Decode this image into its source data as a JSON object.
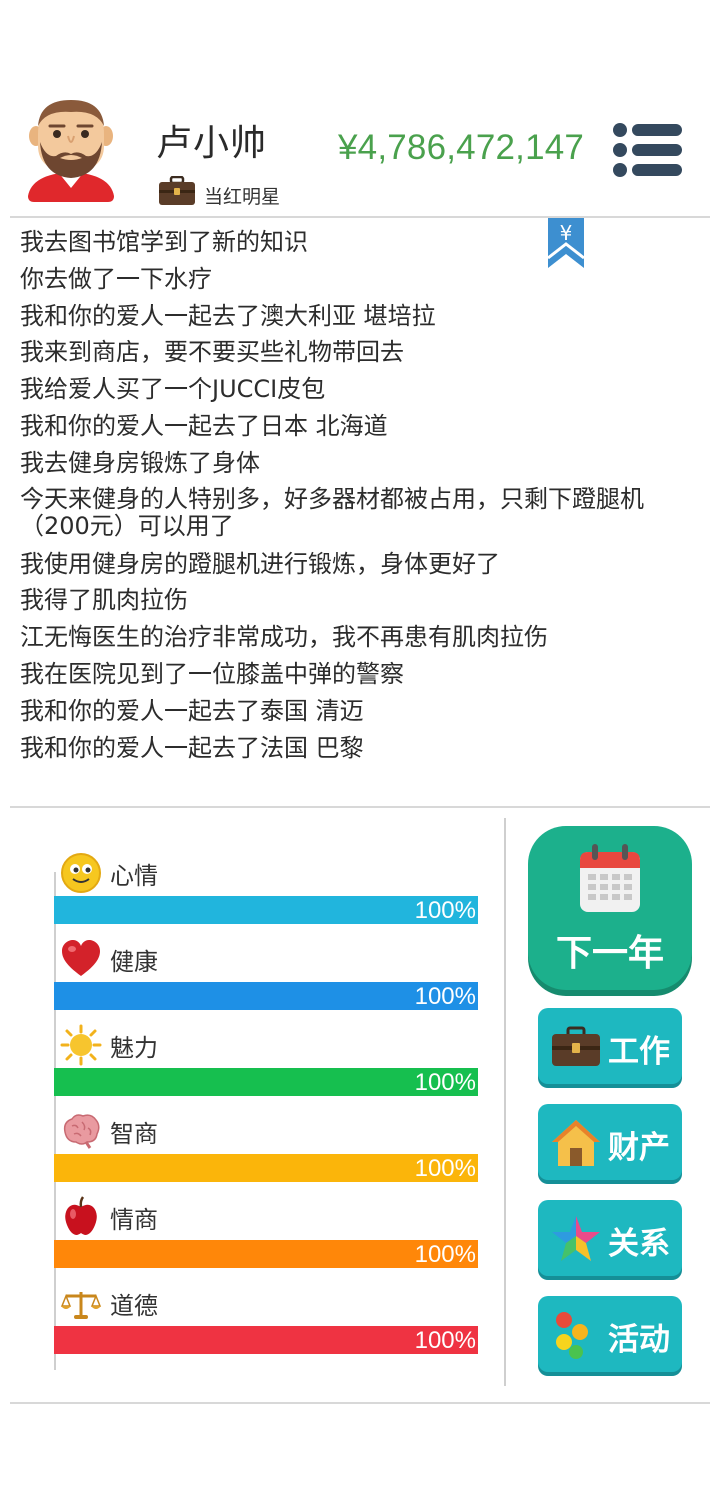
{
  "player": {
    "name": "卢小帅",
    "job": "当红明星",
    "money": "¥4,786,472,147"
  },
  "log": [
    "我去图书馆学到了新的知识",
    "你去做了一下水疗",
    "我和你的爱人一起去了澳大利亚 堪培拉",
    "我来到商店，要不要买些礼物带回去",
    "我给爱人买了一个JUCCI皮包",
    "我和你的爱人一起去了日本 北海道",
    "我去健身房锻炼了身体",
    "今天来健身的人特别多，好多器材都被占用，只剩下蹬腿机（200元）可以用了",
    "我使用健身房的蹬腿机进行锻炼，身体更好了",
    "我得了肌肉拉伤",
    "江无悔医生的治疗非常成功，我不再患有肌肉拉伤",
    "我在医院见到了一位膝盖中弹的警察",
    "我和你的爱人一起去了泰国 清迈",
    "我和你的爱人一起去了法国 巴黎"
  ],
  "bookmark_symbol": "¥",
  "stats": [
    {
      "label": "心情",
      "percent_text": "100%",
      "value": 1.0,
      "color": "#21b5dd",
      "icon": "smiley-icon"
    },
    {
      "label": "健康",
      "percent_text": "100%",
      "value": 1.0,
      "color": "#1e90e6",
      "icon": "heart-icon"
    },
    {
      "label": "魅力",
      "percent_text": "100%",
      "value": 1.0,
      "color": "#16bf4f",
      "icon": "sun-icon"
    },
    {
      "label": "智商",
      "percent_text": "100%",
      "value": 1.0,
      "color": "#fbb50a",
      "icon": "brain-icon"
    },
    {
      "label": "情商",
      "percent_text": "100%",
      "value": 1.0,
      "color": "#ff8709",
      "icon": "apple-icon"
    },
    {
      "label": "道德",
      "percent_text": "100%",
      "value": 1.0,
      "color": "#ef3342",
      "icon": "scales-icon"
    }
  ],
  "actions": {
    "next_year": "下一年",
    "work": "工作",
    "property": "财产",
    "relations": "关系",
    "activity": "活动"
  },
  "colors": {
    "money": "#4aa14d",
    "next_year_button": "#1cb08c",
    "side_button": "#1eb8c0",
    "menu_icon": "#34495e"
  }
}
